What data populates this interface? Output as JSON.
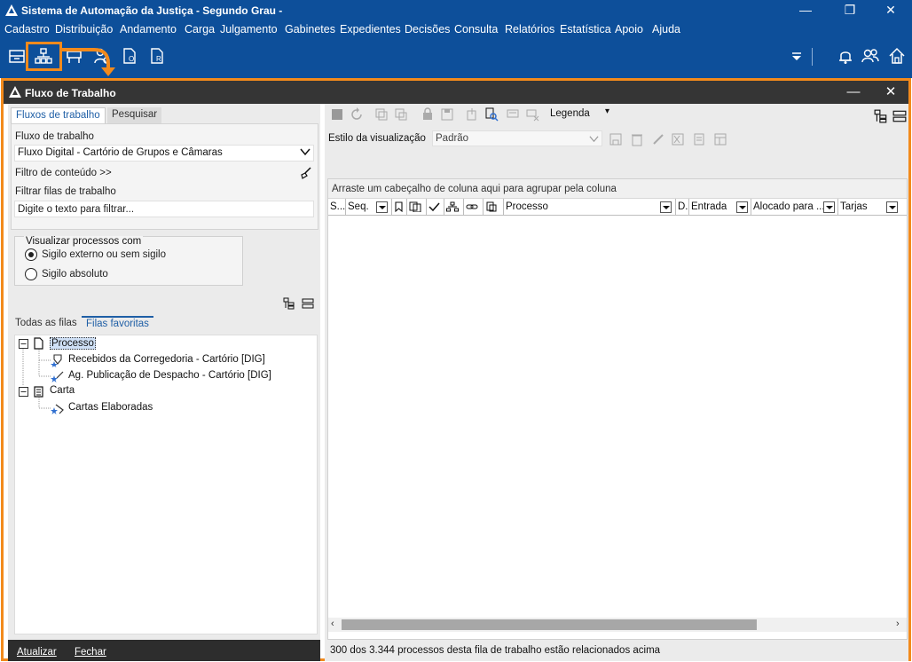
{
  "app": {
    "title": "Sistema de Automação da Justiça - Segundo Grau -",
    "window_controls": [
      "—",
      "❐",
      "✕"
    ]
  },
  "menu": [
    "Cadastro",
    "Distribuição",
    "Andamento",
    "Carga",
    "Julgamento",
    "Gabinetes",
    "Expedientes",
    "Decisões",
    "Consulta",
    "Relatórios",
    "Estatística",
    "Apoio",
    "Ajuda"
  ],
  "toolbar_icons": [
    "inbox-icon",
    "org-chart-icon",
    "desk-icon",
    "person-gear-icon",
    "document-o-icon",
    "document-r-icon"
  ],
  "right_toolbar_icons": [
    "dropdown-icon",
    "bell-icon",
    "users-icon",
    "home-icon"
  ],
  "subwindow": {
    "title": "Fluxo de Trabalho",
    "minimize": "—",
    "close": "✕"
  },
  "left": {
    "tabs": [
      "Fluxos de trabalho",
      "Pesquisar"
    ],
    "workflow_label": "Fluxo de trabalho",
    "workflow_value": "Fluxo Digital - Cartório de Grupos e Câmaras",
    "content_filter": "Filtro de conteúdo >>",
    "filter_queues_label": "Filtrar filas de trabalho",
    "filter_queues_placeholder": "Digite o texto para filtrar...",
    "view_group_caption": "Visualizar processos com",
    "radio_1": "Sigilo externo ou sem sigilo",
    "radio_2": "Sigilo absoluto",
    "radio_selected": 1,
    "queue_tabs": [
      "Todas as filas",
      "Filas favoritas"
    ],
    "tree": {
      "node_1": "Processo",
      "node_1_children": [
        "Recebidos da Corregedoria - Cartório [DIG]",
        "Ag. Publicação de Despacho - Cartório [DIG]"
      ],
      "node_2": "Carta",
      "node_2_children": [
        "Cartas Elaboradas"
      ]
    },
    "footer_update": "Atualizar",
    "footer_close": "Fechar"
  },
  "right": {
    "legend_label": "Legenda",
    "view_style_label": "Estilo da visualização",
    "view_style_value": "Padrão",
    "group_hint": "Arraste um cabeçalho de coluna aqui para agrupar pela coluna",
    "columns": [
      "S...",
      "Seq.",
      "Processo",
      "D.",
      "Entrada",
      "Alocado para ...",
      "Tarjas"
    ],
    "status": "300 dos 3.344 processos desta fila de trabalho estão relacionados acima"
  },
  "colors": {
    "app_blue": "#0d4f9a",
    "highlight_orange": "#f28a1c",
    "subtitle_dark": "#353535",
    "selected_tab_text": "#1f5fa6"
  }
}
